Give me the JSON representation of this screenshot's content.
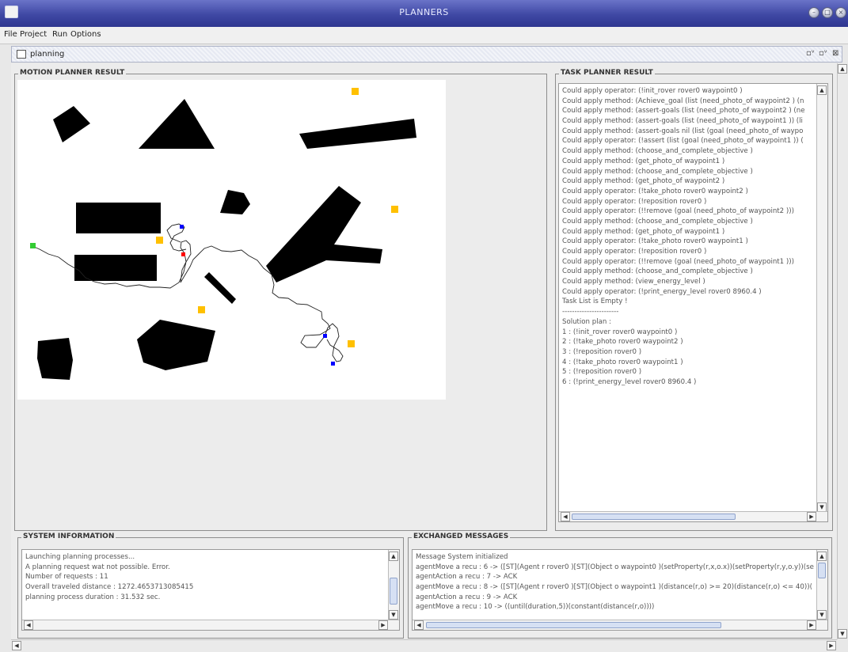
{
  "window": {
    "title": "PLANNERS"
  },
  "menu": [
    "File",
    "Project",
    "Run",
    "Options"
  ],
  "frame": {
    "title": "planning"
  },
  "motion_panel": {
    "title": "MOTION PLANNER RESULT"
  },
  "task_panel": {
    "title": "TASK PLANNER RESULT",
    "lines": [
      "Could apply operator: (!init_rover rover0 waypoint0 )",
      "Could apply method: (Achieve_goal (list (need_photo_of waypoint2 ) (n",
      "Could apply method: (assert-goals (list (need_photo_of waypoint2 ) (ne",
      "Could apply method: (assert-goals (list (need_photo_of waypoint1 )) (li",
      "Could apply method: (assert-goals nil (list (goal (need_photo_of waypo",
      "Could apply operator: (!assert (list (goal (need_photo_of waypoint1 )) (",
      "Could apply method: (choose_and_complete_objective )",
      "Could apply method: (get_photo_of waypoint1 )",
      "Could apply method: (choose_and_complete_objective )",
      "Could apply method: (get_photo_of waypoint2 )",
      "Could apply operator: (!take_photo rover0 waypoint2 )",
      "Could apply operator: (!reposition rover0 )",
      "Could apply operator: (!!remove (goal (need_photo_of waypoint2 )))",
      "Could apply method: (choose_and_complete_objective )",
      "Could apply method: (get_photo_of waypoint1 )",
      "Could apply operator: (!take_photo rover0 waypoint1 )",
      "Could apply operator: (!reposition rover0 )",
      "Could apply operator: (!!remove (goal (need_photo_of waypoint1 )))",
      "Could apply method: (choose_and_complete_objective )",
      "Could apply method: (view_energy_level )",
      "Could apply operator: (!print_energy_level rover0 8960.4 )",
      "Task List is Empty !",
      "-----------------------",
      "Solution plan :",
      "1 : (!init_rover rover0 waypoint0 )",
      "2 : (!take_photo rover0 waypoint2 )",
      "3 : (!reposition rover0 )",
      "4 : (!take_photo rover0 waypoint1 )",
      "5 : (!reposition rover0 )",
      "6 : (!print_energy_level rover0 8960.4 )"
    ]
  },
  "system_panel": {
    "title": "SYSTEM INFORMATION",
    "lines": [
      "Launching planning processes...",
      "A planning request wat not possible. Error.",
      "Number of requests : 11",
      "Overall traveled distance : 1272.4653713085415",
      "planning process duration : 31.532 sec."
    ]
  },
  "messages_panel": {
    "title": "EXCHANGED MESSAGES",
    "lines": [
      "Message System initialized",
      "agentMove a recu : 6 -> ([ST](Agent r rover0 )[ST](Object o waypoint0 )(setProperty(r,x,o.x))(setProperty(r,y,o.y))(se",
      "agentAction a recu : 7 -> ACK",
      "agentMove a recu : 8 -> ([ST](Agent r rover0 )[ST](Object o waypoint1 )(distance(r,o) >= 20)(distance(r,o) <= 40))(",
      "agentAction a recu : 9 -> ACK",
      "agentMove a recu : 10 -> ((until(duration,5))(constant(distance(r,o))))"
    ]
  },
  "colors": {
    "title_bar": "#3f48a4",
    "obstacle": "#000000",
    "waypoint": "#ffc000",
    "rover": "#ff0000",
    "node": "#0000ff",
    "start": "#33cc33"
  }
}
